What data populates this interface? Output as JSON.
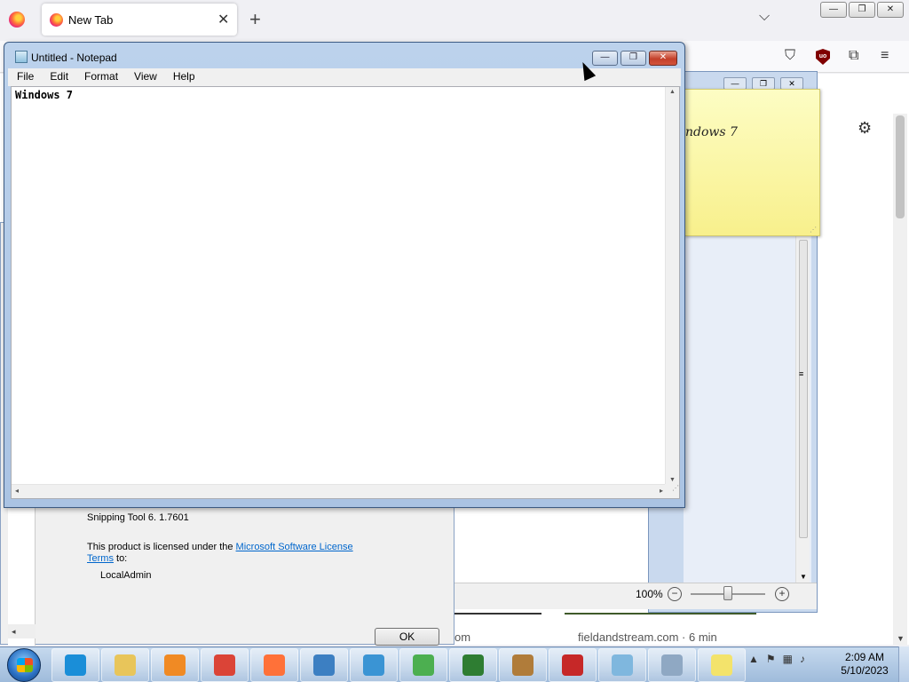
{
  "firefox": {
    "tab_title": "New Tab",
    "tab_close": "✕",
    "new_tab": "+",
    "list_all_tabs": "⌵",
    "window_buttons": [
      "—",
      "❐",
      "✕"
    ],
    "toolbar_icons": {
      "pocket": "⛉",
      "ublock": "uo",
      "extensions": "⧉",
      "menu": "≡"
    },
    "settings_icon": "⚙",
    "news_left": "om",
    "news_right": "fieldandstream.com · 6 min"
  },
  "snipping_about": {
    "version": "Snipping Tool 6. 1.7601",
    "license_prefix": "This product is licensed under the ",
    "license_link": "Microsoft Software License Terms",
    "license_suffix": " to:",
    "user": "LocalAdmin",
    "ok_label": "OK",
    "scroll_left": "◂"
  },
  "background_window": {
    "buttons": [
      "—",
      "❐",
      "✕"
    ],
    "zoom": "100%",
    "zoom_minus": "−",
    "zoom_plus": "+"
  },
  "sticky_note": {
    "text": "ndows 7"
  },
  "notepad": {
    "title": "Untitled - Notepad",
    "buttons": {
      "minimize": "—",
      "maximize": "❐",
      "close": "✕"
    },
    "menu": [
      "File",
      "Edit",
      "Format",
      "View",
      "Help"
    ],
    "content": "Windows 7",
    "scroll": {
      "up": "▲",
      "down": "▼",
      "left": "◂",
      "right": "▸"
    }
  },
  "taskbar": {
    "apps": [
      {
        "name": "internet-explorer",
        "color": "#1a8ed8"
      },
      {
        "name": "windows-explorer",
        "color": "#e8c55a"
      },
      {
        "name": "media-player",
        "color": "#f08a24"
      },
      {
        "name": "chrome",
        "color": "#db4437"
      },
      {
        "name": "firefox",
        "color": "#ff7139"
      },
      {
        "name": "control-panel",
        "color": "#3c7fc2"
      },
      {
        "name": "windows-update",
        "color": "#3a94d4"
      },
      {
        "name": "windows-logo-green",
        "color": "#4caf50"
      },
      {
        "name": "task-manager",
        "color": "#2e7d32"
      },
      {
        "name": "paint",
        "color": "#b07c3a"
      },
      {
        "name": "snipping-tool",
        "color": "#c62828"
      },
      {
        "name": "notepad",
        "color": "#7fb7de"
      },
      {
        "name": "calculator",
        "color": "#8fa8c3"
      },
      {
        "name": "sticky-notes",
        "color": "#f3e36b"
      }
    ],
    "tray_arrow": "▲",
    "clock_time": "2:09 AM",
    "clock_date": "5/10/2023"
  }
}
